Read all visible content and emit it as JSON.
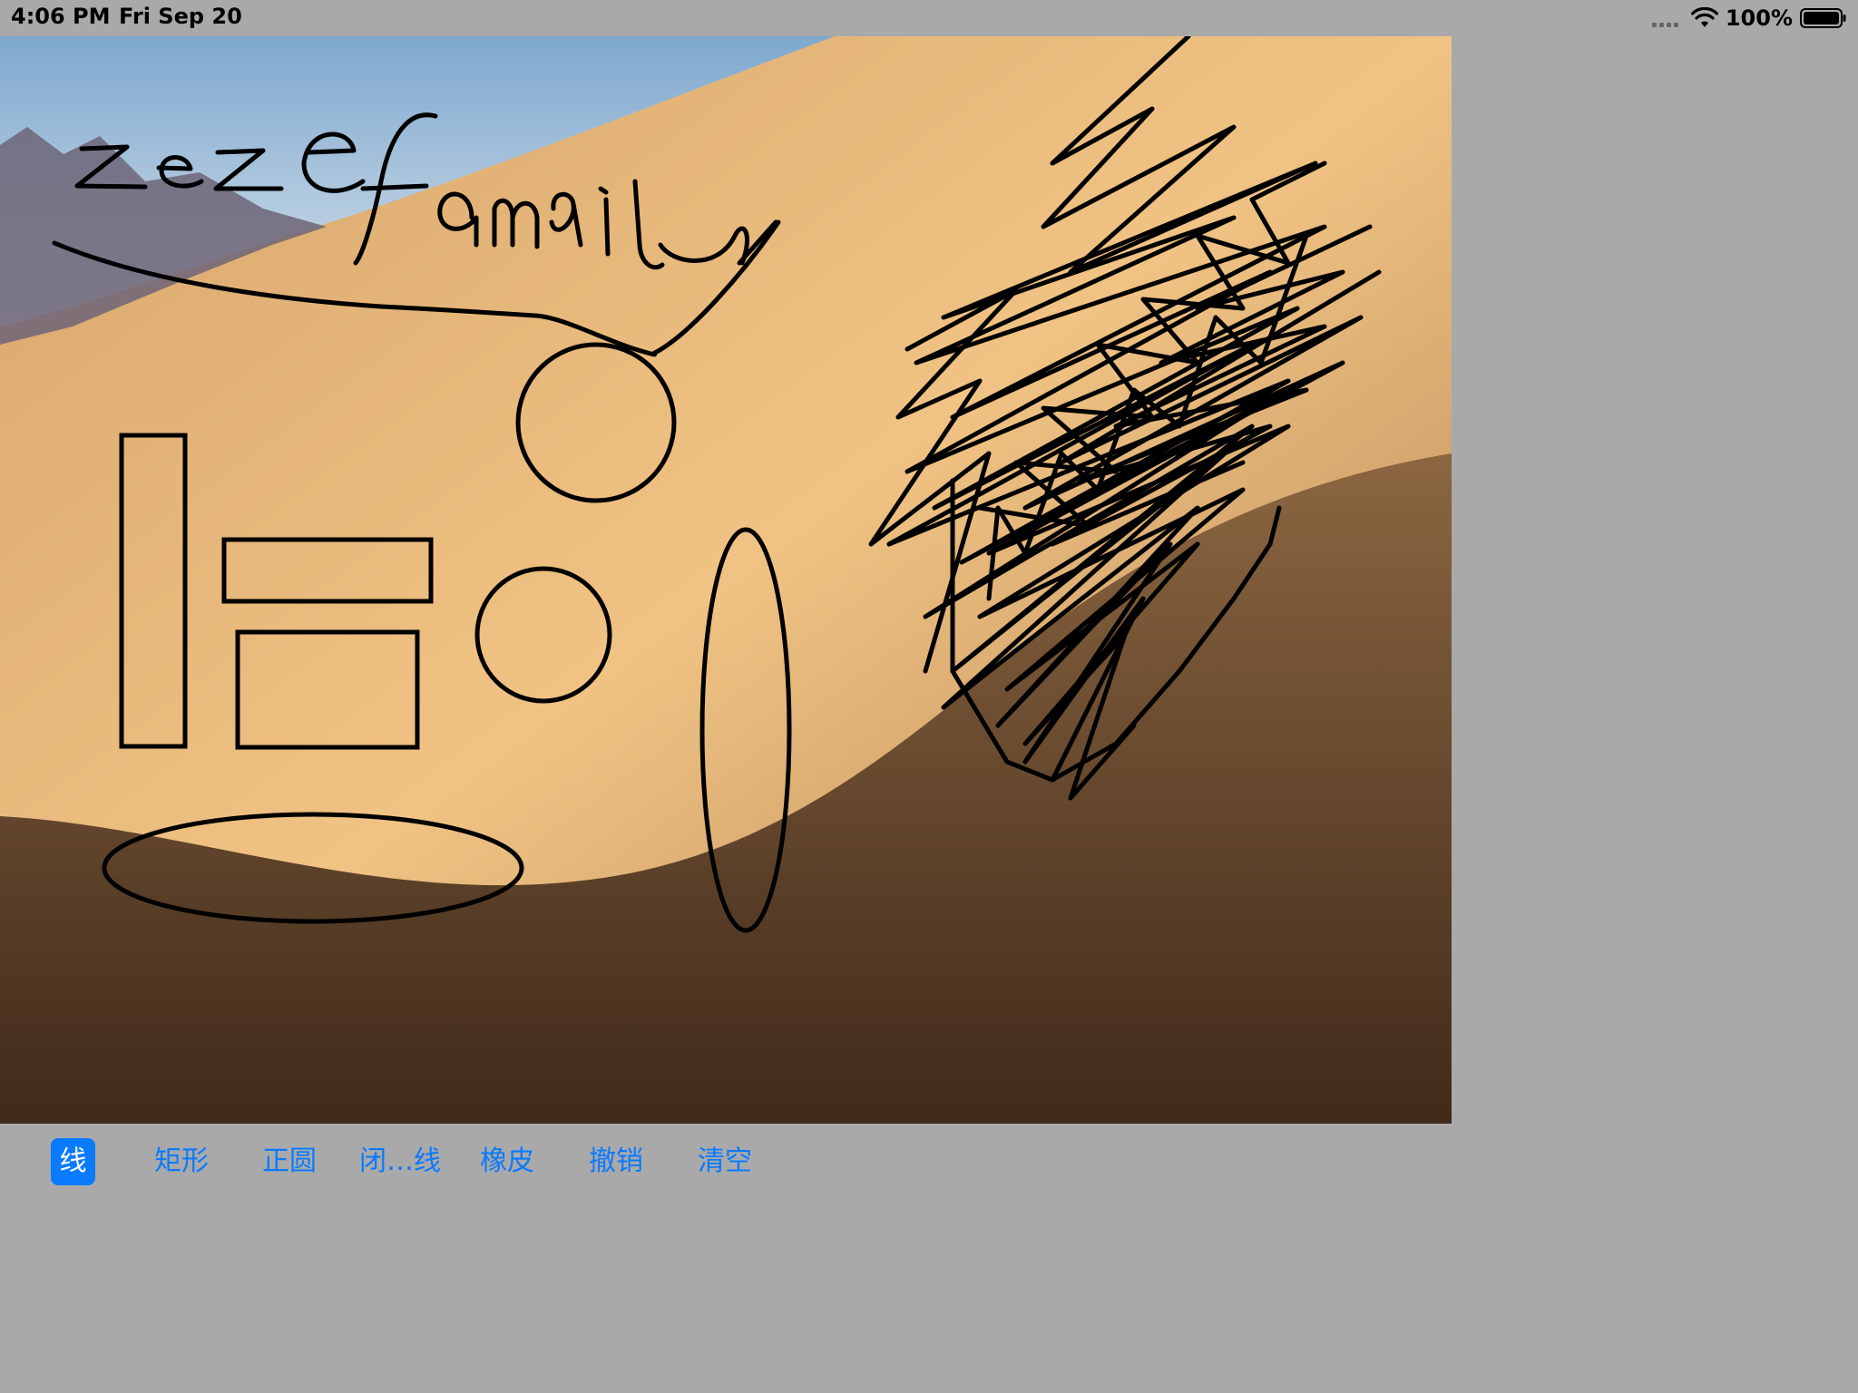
{
  "status_bar": {
    "time": "4:06 PM",
    "date": "Fri Sep 20",
    "battery_percent": "100%",
    "icons": [
      "signal-dots-icon",
      "wifi-icon",
      "battery-icon"
    ]
  },
  "canvas": {
    "handwriting": "zezefamily",
    "background": "desert-dunes-wallpaper"
  },
  "toolbar": {
    "selected_index": 0,
    "accent_color": "#0a7aff",
    "items": [
      {
        "label": "线"
      },
      {
        "label": "矩形"
      },
      {
        "label": "正圆"
      },
      {
        "label": "闭…线"
      },
      {
        "label": "橡皮"
      },
      {
        "label": "撤销"
      },
      {
        "label": "清空"
      }
    ]
  }
}
